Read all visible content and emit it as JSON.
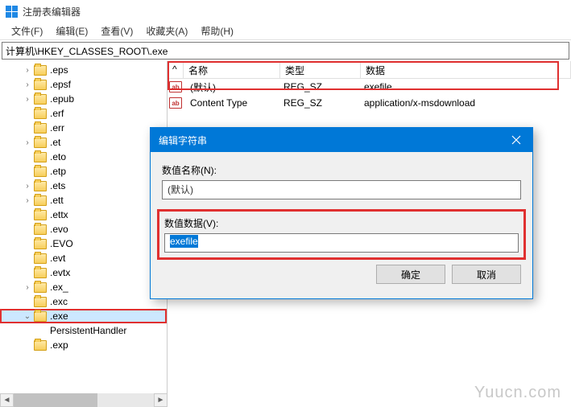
{
  "window": {
    "title": "注册表编辑器"
  },
  "menu": {
    "file": "文件(F)",
    "edit": "编辑(E)",
    "view": "查看(V)",
    "favorites": "收藏夹(A)",
    "help": "帮助(H)"
  },
  "path": "计算机\\HKEY_CLASSES_ROOT\\.exe",
  "tree": {
    "items": [
      {
        "label": ".eps",
        "expand": ">"
      },
      {
        "label": ".epsf",
        "expand": ">"
      },
      {
        "label": ".epub",
        "expand": ">"
      },
      {
        "label": ".erf",
        "expand": ""
      },
      {
        "label": ".err",
        "expand": ""
      },
      {
        "label": ".et",
        "expand": ">"
      },
      {
        "label": ".eto",
        "expand": ""
      },
      {
        "label": ".etp",
        "expand": ""
      },
      {
        "label": ".ets",
        "expand": ">"
      },
      {
        "label": ".ett",
        "expand": ">"
      },
      {
        "label": ".ettx",
        "expand": ""
      },
      {
        "label": ".evo",
        "expand": ""
      },
      {
        "label": ".EVO",
        "expand": ""
      },
      {
        "label": ".evt",
        "expand": ""
      },
      {
        "label": ".evtx",
        "expand": ""
      },
      {
        "label": ".ex_",
        "expand": ">"
      },
      {
        "label": ".exc",
        "expand": ""
      },
      {
        "label": ".exe",
        "expand": "v",
        "selected": true,
        "highlight": true
      },
      {
        "label": "PersistentHandler",
        "child": true,
        "expand": ""
      },
      {
        "label": ".exp",
        "expand": ""
      }
    ]
  },
  "list": {
    "columns": {
      "name": "名称",
      "type": "类型",
      "data": "数据"
    },
    "rows": [
      {
        "name": "(默认)",
        "type": "REG_SZ",
        "data": "exefile",
        "highlight": true
      },
      {
        "name": "Content Type",
        "type": "REG_SZ",
        "data": "application/x-msdownload"
      }
    ]
  },
  "dialog": {
    "title": "编辑字符串",
    "name_label": "数值名称(N):",
    "name_value": "(默认)",
    "data_label": "数值数据(V):",
    "data_value": "exefile",
    "ok": "确定",
    "cancel": "取消"
  },
  "watermark": "Yuucn.com"
}
